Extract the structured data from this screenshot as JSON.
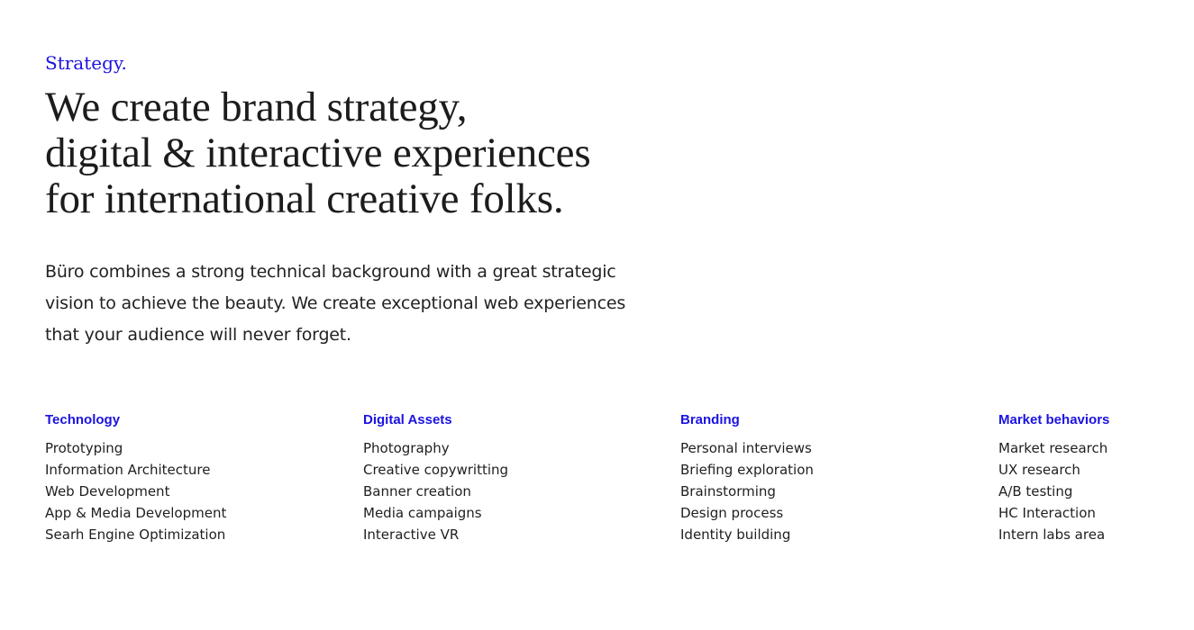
{
  "strategy": {
    "eyebrow": "Strategy.",
    "headline_lines": [
      "We create brand strategy,",
      "digital & interactive experiences",
      "for international creative folks."
    ],
    "intro_lines": [
      "Büro combines a strong technical background with a great strategic",
      "vision to achieve the beauty. We create exceptional web experiences",
      "that your audience will never forget."
    ]
  },
  "columns": [
    {
      "title": "Technology",
      "items": [
        "Prototyping",
        "Information Architecture",
        "Web Development",
        "App & Media Development",
        "Searh Engine Optimization"
      ]
    },
    {
      "title": "Digital Assets",
      "items": [
        "Photography",
        "Creative copywritting",
        "Banner creation",
        "Media campaigns",
        "Interactive VR"
      ]
    },
    {
      "title": "Branding",
      "items": [
        "Personal interviews",
        "Briefing exploration",
        "Brainstorming",
        "Design process",
        "Identity building"
      ]
    },
    {
      "title": "Market behaviors",
      "items": [
        "Market research",
        "UX research",
        "A/B testing",
        "HC Interaction",
        "Intern labs area"
      ]
    }
  ],
  "colors": {
    "accent": "#1b13e0",
    "text": "#1c1c1c",
    "background": "#ffffff"
  }
}
